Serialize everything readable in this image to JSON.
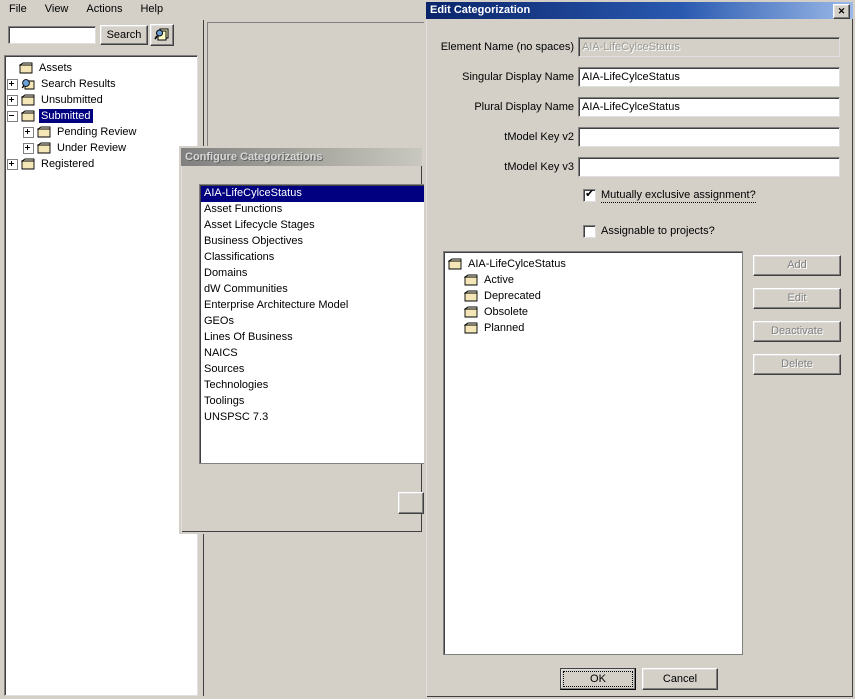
{
  "app": {
    "menu": [
      {
        "label": "File"
      },
      {
        "label": "View"
      },
      {
        "label": "Actions"
      },
      {
        "label": "Help"
      }
    ],
    "toolbar": {
      "search_value": "",
      "search_placeholder": "",
      "search_button": "Search",
      "tool_icon": "search-assets-icon"
    },
    "tree": {
      "root": {
        "label": "Assets",
        "icon": "folder-icon",
        "expander": "none",
        "selected": false
      },
      "items": [
        {
          "label": "Search Results",
          "icon": "search-folder-icon",
          "expander": "plus",
          "indent": 0,
          "selected": false
        },
        {
          "label": "Unsubmitted",
          "icon": "folder-icon",
          "expander": "plus",
          "indent": 0,
          "selected": false
        },
        {
          "label": "Submitted",
          "icon": "folder-icon",
          "expander": "minus",
          "indent": 0,
          "selected": true
        },
        {
          "label": "Pending Review",
          "icon": "folder-icon",
          "expander": "plus",
          "indent": 1,
          "selected": false
        },
        {
          "label": "Under Review",
          "icon": "folder-icon",
          "expander": "plus",
          "indent": 1,
          "selected": false
        },
        {
          "label": "Registered",
          "icon": "folder-icon",
          "expander": "plus",
          "indent": 0,
          "selected": false
        }
      ]
    }
  },
  "configure_dialog": {
    "title": "Configure Categorizations",
    "active": false,
    "list": [
      {
        "label": "AIA-LifeCylceStatus",
        "selected": true
      },
      {
        "label": "Asset Functions",
        "selected": false
      },
      {
        "label": "Asset Lifecycle Stages",
        "selected": false
      },
      {
        "label": "Business Objectives",
        "selected": false
      },
      {
        "label": "Classifications",
        "selected": false
      },
      {
        "label": "Domains",
        "selected": false
      },
      {
        "label": "dW Communities",
        "selected": false
      },
      {
        "label": "Enterprise Architecture Model",
        "selected": false
      },
      {
        "label": "GEOs",
        "selected": false
      },
      {
        "label": "Lines Of Business",
        "selected": false
      },
      {
        "label": "NAICS",
        "selected": false
      },
      {
        "label": "Sources",
        "selected": false
      },
      {
        "label": "Technologies",
        "selected": false
      },
      {
        "label": "Toolings",
        "selected": false
      },
      {
        "label": "UNSPSC 7.3",
        "selected": false
      }
    ]
  },
  "edit_dialog": {
    "title": "Edit Categorization",
    "close_glyph": "✕",
    "fields": [
      {
        "label": "Element Name (no spaces)",
        "value": "AIA-LifeCylceStatus",
        "disabled": true
      },
      {
        "label": "Singular Display Name",
        "value": "AIA-LifeCylceStatus",
        "disabled": false
      },
      {
        "label": "Plural Display Name",
        "value": "AIA-LifeCylceStatus",
        "disabled": false
      },
      {
        "label": "tModel Key v2",
        "value": "",
        "disabled": false
      },
      {
        "label": "tModel Key v3",
        "value": "",
        "disabled": false
      }
    ],
    "checkboxes": [
      {
        "label": "Mutually exclusive assignment?",
        "checked": true,
        "focused": true
      },
      {
        "label": "Assignable to projects?",
        "checked": false,
        "focused": false
      }
    ],
    "tree": {
      "root": {
        "label": "AIA-LifeCylceStatus",
        "icon": "folder-icon"
      },
      "children": [
        {
          "label": "Active",
          "icon": "folder-icon"
        },
        {
          "label": "Deprecated",
          "icon": "folder-icon"
        },
        {
          "label": "Obsolete",
          "icon": "folder-icon"
        },
        {
          "label": "Planned",
          "icon": "folder-icon"
        }
      ]
    },
    "side_buttons": [
      {
        "label": "Add",
        "disabled": true
      },
      {
        "label": "Edit",
        "disabled": true
      },
      {
        "label": "Deactivate",
        "disabled": true
      },
      {
        "label": "Delete",
        "disabled": true
      }
    ],
    "footer_buttons": [
      {
        "label": "OK",
        "default": true
      },
      {
        "label": "Cancel",
        "default": false
      }
    ]
  },
  "colors": {
    "face": "#d4d0c8",
    "active_title_start": "#0a246a",
    "active_title_end": "#9bb9e8",
    "inactive_title": "#808080",
    "selection": "#000080",
    "disabled_text": "#808080"
  }
}
